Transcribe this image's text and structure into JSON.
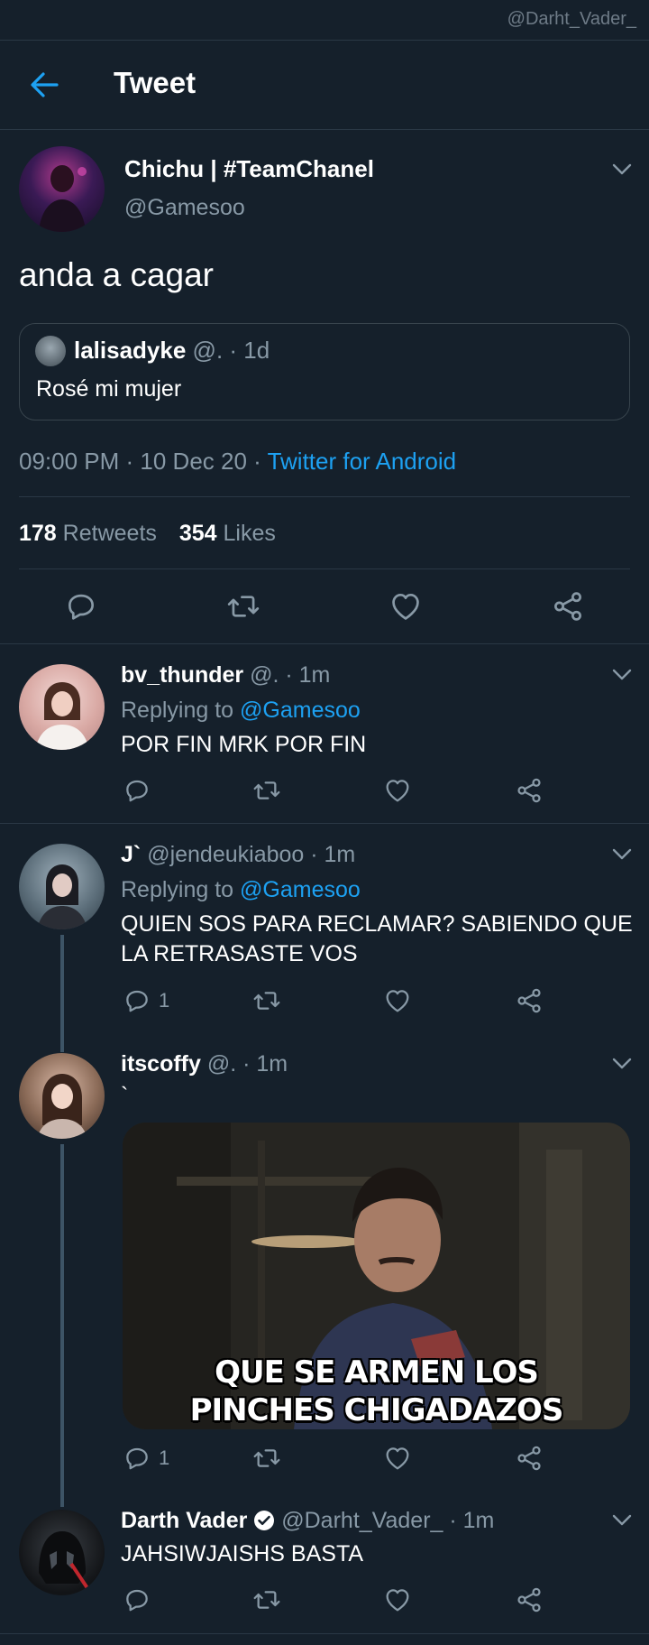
{
  "watermark": "@Darht_Vader_",
  "header": {
    "title": "Tweet"
  },
  "main_tweet": {
    "name": "Chichu | #TeamChanel",
    "handle": "@Gamesoo",
    "text": "anda a cagar",
    "quote": {
      "name": "lalisadyke",
      "meta": "@. · 1d",
      "text": "Rosé mi mujer"
    },
    "time_date": "09:00 PM · 10 Dec 20 · ",
    "client": "Twitter for Android",
    "retweets_count": "178",
    "retweets_label": "Retweets",
    "likes_count": "354",
    "likes_label": "Likes"
  },
  "replies": [
    {
      "name": "bv_thunder",
      "meta": "@. · 1m",
      "replying_prefix": "Replying to ",
      "replying_to": "@Gamesoo",
      "text": "POR FIN MRK POR FIN",
      "reply_count": ""
    },
    {
      "name": "J`",
      "meta": "@jendeukiaboo · 1m",
      "replying_prefix": "Replying to ",
      "replying_to": "@Gamesoo",
      "text_line1": "QUIEN SOS PARA RECLAMAR? SABIENDO QUE",
      "text_line2": "LA RETRASASTE VOS",
      "reply_count": "1"
    },
    {
      "name": "itscoffy",
      "meta": "@. · 1m",
      "text": "`",
      "gif_caption_line1": "QUE SE ARMEN LOS",
      "gif_caption_line2": "PINCHES CHIGADAZOS",
      "reply_count": "1"
    },
    {
      "name": "Darth Vader",
      "meta": "@Darht_Vader_ · 1m",
      "text": "JAHSIWJAISHS BASTA",
      "reply_count": ""
    }
  ],
  "colors": {
    "background": "#15202b",
    "accent": "#1da1f2",
    "muted": "#8899a6",
    "divider": "#2a3845"
  },
  "icons": [
    "back-arrow-icon",
    "chevron-down-icon",
    "reply-icon",
    "retweet-icon",
    "like-icon",
    "share-icon",
    "verified-icon"
  ]
}
